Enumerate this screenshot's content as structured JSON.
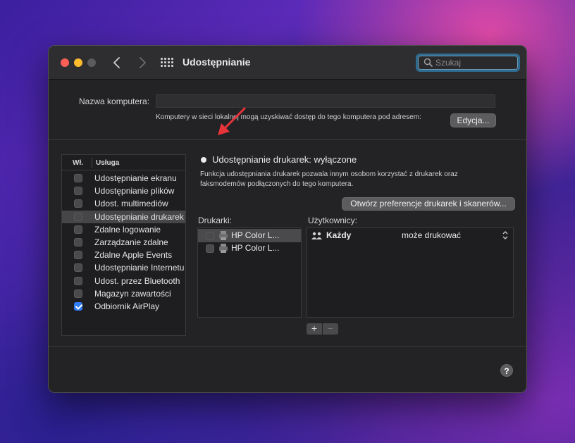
{
  "window": {
    "title": "Udostępnianie"
  },
  "toolbar": {
    "back_icon": "chevron-left-icon",
    "forward_icon": "chevron-right-icon",
    "grid_icon": "grid-icon",
    "search_placeholder": "Szukaj"
  },
  "computer_name": {
    "label": "Nazwa komputera:",
    "value": "",
    "note": "Komputery w sieci lokalnej mogą uzyskiwać dostęp do tego komputera pod adresem:",
    "edit_button": "Edycja..."
  },
  "services": {
    "header_on": "Wł.",
    "header_service": "Usługa",
    "items": [
      {
        "label": "Udostępnianie ekranu",
        "checked": false,
        "selected": false
      },
      {
        "label": "Udostępnianie plików",
        "checked": false,
        "selected": false
      },
      {
        "label": "Udost. multimediów",
        "checked": false,
        "selected": false
      },
      {
        "label": "Udostępnianie drukarek",
        "checked": false,
        "selected": true
      },
      {
        "label": "Zdalne logowanie",
        "checked": false,
        "selected": false
      },
      {
        "label": "Zarządzanie zdalne",
        "checked": false,
        "selected": false
      },
      {
        "label": "Zdalne Apple Events",
        "checked": false,
        "selected": false
      },
      {
        "label": "Udostępnianie Internetu",
        "checked": false,
        "selected": false
      },
      {
        "label": "Udost. przez Bluetooth",
        "checked": false,
        "selected": false
      },
      {
        "label": "Magazyn zawartości",
        "checked": false,
        "selected": false
      },
      {
        "label": "Odbiornik AirPlay",
        "checked": true,
        "selected": false
      }
    ]
  },
  "detail": {
    "status": "Udostępnianie drukarek: wyłączone",
    "description": "Funkcja udostępniania drukarek pozwala innym osobom korzystać z drukarek oraz faksmodemów podłączonych do tego komputera.",
    "open_prefs_button": "Otwórz preferencje drukarek i skanerów...",
    "printers_label": "Drukarki:",
    "printers": [
      {
        "label": "HP Color L...",
        "selected": true
      },
      {
        "label": "HP Color L...",
        "selected": false
      }
    ],
    "users_label": "Użytkownicy:",
    "users": [
      {
        "name": "Każdy",
        "permission": "może drukować"
      }
    ],
    "add_label": "+",
    "remove_label": "−"
  },
  "help_label": "?",
  "colors": {
    "accent_checkbox": "#2f7cf6",
    "close": "#fe5f57",
    "minimize": "#febc2e",
    "annotation_arrow": "#e8333a",
    "search_focus": "#2e6b8f"
  }
}
